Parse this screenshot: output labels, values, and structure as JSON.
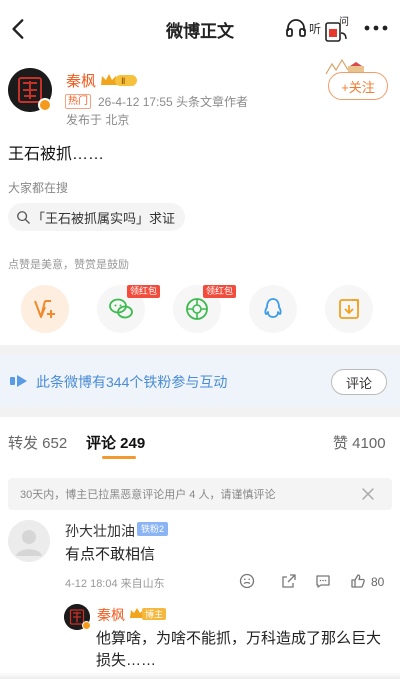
{
  "topbar": {
    "title": "微博正文",
    "listen_label": "听",
    "ask_label": "问"
  },
  "author": {
    "name": "秦枫",
    "level_badge": "Ⅱ",
    "hot_tag": "热门",
    "meta": "26-4-12 17:55  头条文章作者",
    "location": "发布于 北京",
    "follow_label": "+关注"
  },
  "post": {
    "text": "王石被抓……"
  },
  "search": {
    "label": "大家都在搜",
    "chip": "「王石被抓属实吗」求证"
  },
  "reward": {
    "label": "点赞是美意，赞赏是鼓励",
    "redpack_label": "领红包"
  },
  "fans_bar": {
    "text": "此条微博有344个铁粉参与互动",
    "button": "评论"
  },
  "tabs": {
    "repost": "转发 652",
    "comment": "评论 249",
    "like": "赞 4100"
  },
  "notice": "30天内，博主已拉黑恶意评论用户 4 人，请谨慎评论",
  "comment": {
    "name": "孙大壮加油",
    "badge": "铁粉2",
    "text": "有点不敢相信",
    "meta": "4-12 18:04  来自山东",
    "likes": "80"
  },
  "reply": {
    "name": "秦枫",
    "badge": "博主",
    "text": "他算啥，为啥不能抓，万科造成了那么巨大损失……"
  },
  "colors": {
    "accent_orange": "#f45b1e",
    "link_blue": "#4b8cd6",
    "tab_indicator": "#f29a2e"
  }
}
